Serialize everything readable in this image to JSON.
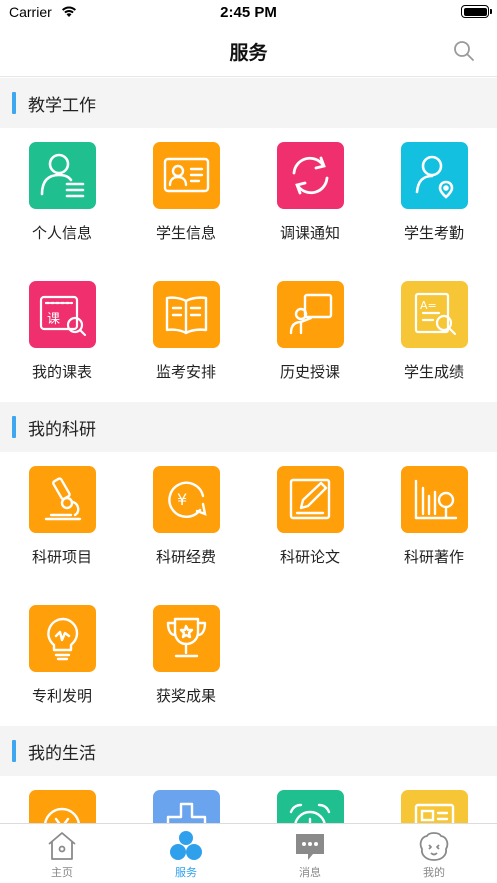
{
  "status_bar": {
    "carrier": "Carrier",
    "time": "2:45 PM"
  },
  "nav": {
    "title": "服务"
  },
  "sections": [
    {
      "title": "教学工作",
      "items": [
        {
          "label": "个人信息",
          "color": "#1fbf8f",
          "icon": "user-card-icon"
        },
        {
          "label": "学生信息",
          "color": "#ff9f0a",
          "icon": "id-card-icon"
        },
        {
          "label": "调课通知",
          "color": "#f0306e",
          "icon": "refresh-icon"
        },
        {
          "label": "学生考勤",
          "color": "#14c0e0",
          "icon": "user-location-icon"
        },
        {
          "label": "我的课表",
          "color": "#f0306e",
          "icon": "schedule-search-icon"
        },
        {
          "label": "监考安排",
          "color": "#ff9f0a",
          "icon": "book-icon"
        },
        {
          "label": "历史授课",
          "color": "#ff9f0a",
          "icon": "lecture-icon"
        },
        {
          "label": "学生成绩",
          "color": "#f7c636",
          "icon": "grade-search-icon"
        }
      ]
    },
    {
      "title": "我的科研",
      "items": [
        {
          "label": "科研项目",
          "color": "#ff9f0a",
          "icon": "microscope-icon"
        },
        {
          "label": "科研经费",
          "color": "#ff9f0a",
          "icon": "yen-coin-icon"
        },
        {
          "label": "科研论文",
          "color": "#ff9f0a",
          "icon": "edit-paper-icon"
        },
        {
          "label": "科研著作",
          "color": "#ff9f0a",
          "icon": "books-icon"
        },
        {
          "label": "专利发明",
          "color": "#ff9f0a",
          "icon": "lightbulb-icon"
        },
        {
          "label": "获奖成果",
          "color": "#ff9f0a",
          "icon": "trophy-icon"
        }
      ]
    },
    {
      "title": "我的生活",
      "items": [
        {
          "label": "",
          "color": "#ff9f0a",
          "icon": "clock-icon"
        },
        {
          "label": "",
          "color": "#6ba4ee",
          "icon": "medical-icon"
        },
        {
          "label": "",
          "color": "#1fbf8f",
          "icon": "alarm-icon"
        },
        {
          "label": "",
          "color": "#f7c636",
          "icon": "card-icon"
        }
      ]
    }
  ],
  "tabs": [
    {
      "label": "主页",
      "icon": "home-icon",
      "active": false
    },
    {
      "label": "服务",
      "icon": "services-icon",
      "active": true
    },
    {
      "label": "消息",
      "icon": "message-icon",
      "active": false
    },
    {
      "label": "我的",
      "icon": "profile-icon",
      "active": false
    }
  ],
  "colors": {
    "accent": "#2fa0ec",
    "section_bar": "#3fa6f0",
    "section_bg": "#f4f4f4"
  }
}
